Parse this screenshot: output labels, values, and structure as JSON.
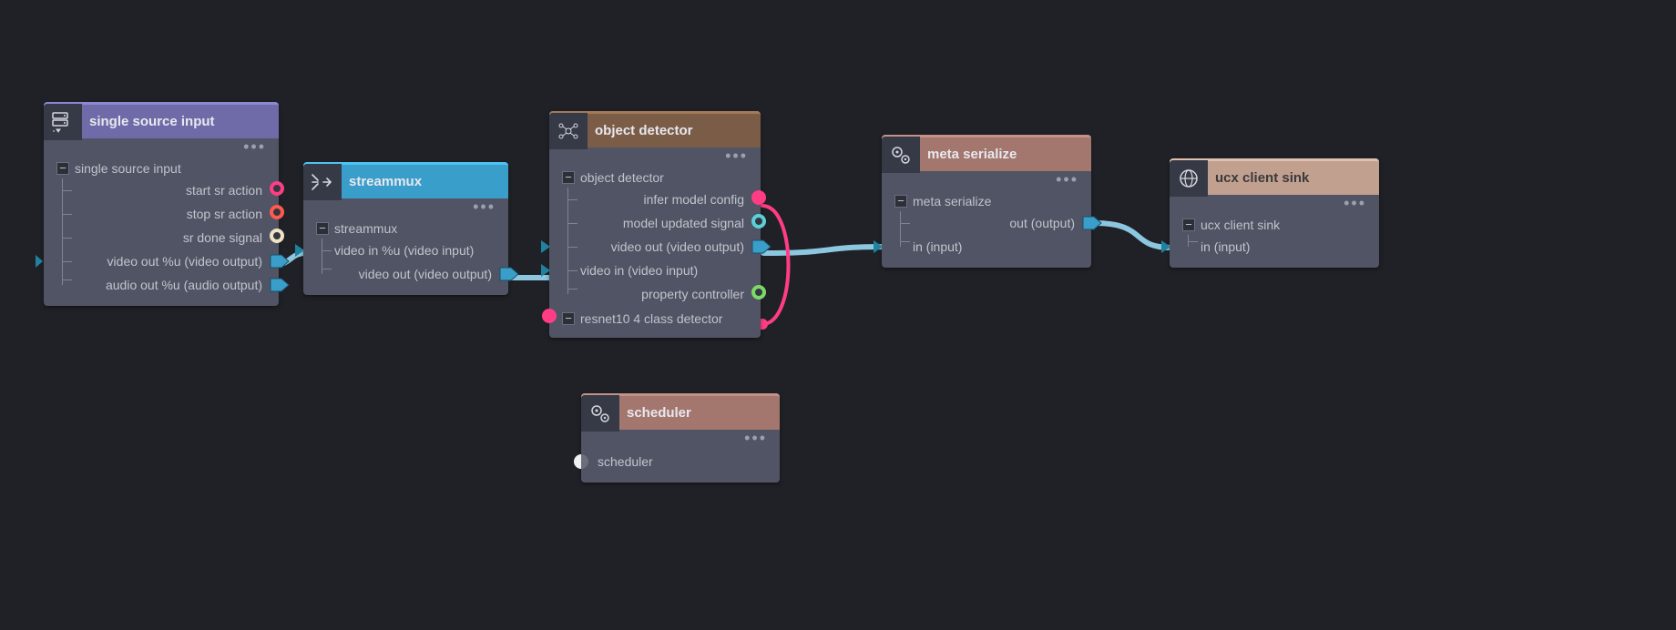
{
  "nodes": {
    "single_source": {
      "title": "single source input",
      "section": "single source input",
      "ports": [
        {
          "label": "start sr action",
          "side": "out",
          "shape": "ring-pink"
        },
        {
          "label": "stop sr action",
          "side": "out",
          "shape": "ring-red"
        },
        {
          "label": "sr done signal",
          "side": "out",
          "shape": "ring-cream"
        },
        {
          "label": "video out %u (video output)",
          "side": "out",
          "shape": "arrow-blue"
        },
        {
          "label": "audio out %u (audio output)",
          "side": "out",
          "shape": "arrow-blue"
        }
      ]
    },
    "streammux": {
      "title": "streammux",
      "section": "streammux",
      "ports": [
        {
          "label": "video in %u (video input)",
          "side": "in",
          "shape": "arrow-blue-in"
        },
        {
          "label": "video out (video output)",
          "side": "out",
          "shape": "arrow-blue"
        }
      ]
    },
    "object_detector": {
      "title": "object detector",
      "section": "object detector",
      "ports": [
        {
          "label": "infer model config",
          "side": "out",
          "shape": "ring-pink"
        },
        {
          "label": "model updated signal",
          "side": "out",
          "shape": "ring-teal"
        },
        {
          "label": "video out (video output)",
          "side": "out",
          "shape": "arrow-blue",
          "also_in": true
        },
        {
          "label": "video in (video input)",
          "side": "in",
          "shape": "arrow-blue-in"
        },
        {
          "label": "property controller",
          "side": "out",
          "shape": "ring-green"
        }
      ],
      "section2": "resnet10 4 class detector",
      "section2_shape": "dot-pink"
    },
    "meta_serialize": {
      "title": "meta serialize",
      "section": "meta serialize",
      "ports": [
        {
          "label": "out (output)",
          "side": "out",
          "shape": "arrow-blue"
        },
        {
          "label": "in (input)",
          "side": "in",
          "shape": "arrow-blue-in"
        }
      ]
    },
    "ucx": {
      "title": "ucx client sink",
      "section": "ucx client sink",
      "ports": [
        {
          "label": "in (input)",
          "side": "in",
          "shape": "arrow-blue-in"
        }
      ]
    },
    "scheduler": {
      "title": "scheduler",
      "section": "scheduler"
    }
  },
  "colors": {
    "bg": "#1f2126",
    "wire": "#8cc6df",
    "wire_pink": "#ff3d84"
  }
}
